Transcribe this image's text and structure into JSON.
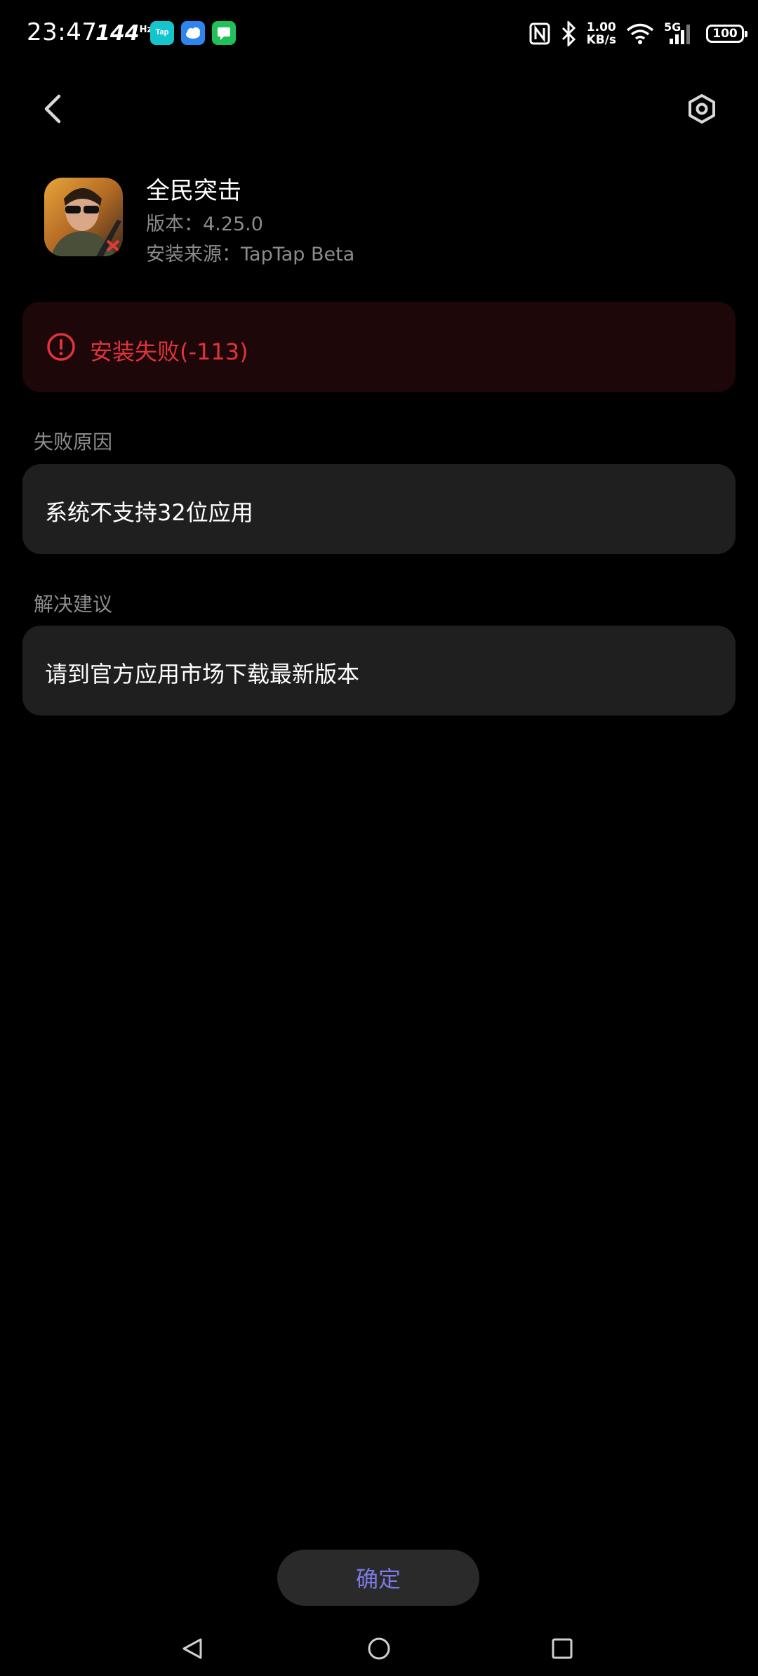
{
  "status_bar": {
    "time": "23:47",
    "refresh_rate": "144",
    "refresh_unit": "Hz",
    "network_speed_value": "1.00",
    "network_speed_unit": "KB/s",
    "network_type": "5G",
    "battery": "100",
    "icons": [
      "taptap-icon",
      "weather-icon",
      "messages-icon",
      "nfc-icon",
      "bluetooth-icon",
      "wifi-icon",
      "signal-icon",
      "battery-icon"
    ]
  },
  "toolbar": {
    "back_icon": "chevron-left-icon",
    "settings_icon": "hexagon-settings-icon"
  },
  "app": {
    "name": "全民突击",
    "version": "版本：4.25.0",
    "source": "安装来源：TapTap Beta"
  },
  "error": {
    "message": "安装失败(-113)",
    "color": "#e0343c",
    "background": "#1e0708"
  },
  "failure_reason": {
    "label": "失败原因",
    "text": "系统不支持32位应用"
  },
  "suggestion": {
    "label": "解决建议",
    "text": "请到官方应用市场下载最新版本"
  },
  "confirm": {
    "label": "确定",
    "color": "#7d79e6"
  },
  "nav_bar": {
    "icons": [
      "back-triangle-icon",
      "home-circle-icon",
      "recents-square-icon"
    ]
  }
}
